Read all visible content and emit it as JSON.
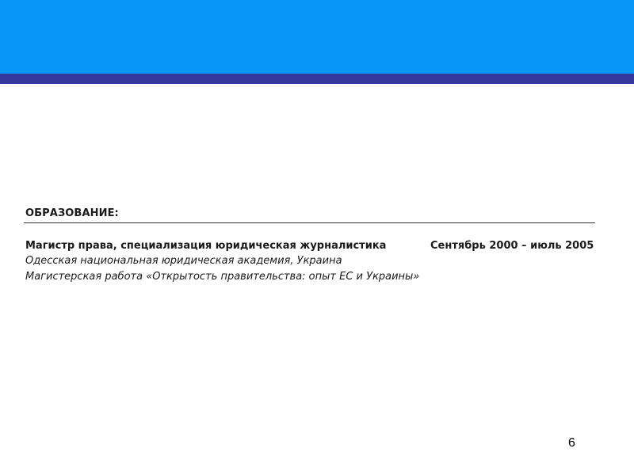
{
  "colors": {
    "header_band": "#0a96fb",
    "header_stripe": "#353a9a",
    "text": "#1a1a1a",
    "rule": "#333333"
  },
  "education": {
    "title": "ОБРАЗОВАНИЕ:",
    "degree": "Магистр права, специализация юридическая журналистика",
    "period": "Сентябрь 2000 – июль 2005",
    "institution": "Одесская национальная юридическая академия, Украина",
    "thesis": "Магистерская работа «Открытость правительства: опыт ЕС и Украины»"
  },
  "page_number": "6"
}
